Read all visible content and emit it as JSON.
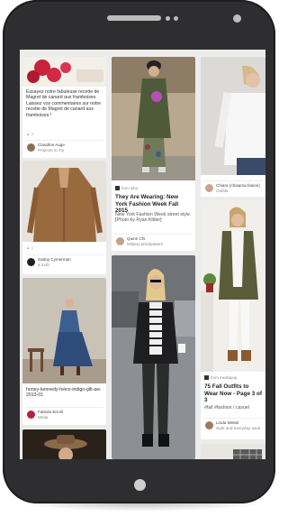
{
  "feed": {
    "col1": {
      "card1": {
        "text": "Essayez notre fabuleuse recette de Magret de canard aux framboises. Laissez vos commentaires sur notre recette de Magret de canard aux framboises !",
        "likes": "▲ 2",
        "user": "Claudine Auge",
        "board": "Projects to Try"
      },
      "card2": {
        "likes": "▲ 1",
        "user": "Sadoy Cymerman",
        "board": "a mob"
      },
      "card3": {
        "text": "honey-kennedy-heinz-indigo-gilt-aw-2013-01",
        "user": "Fabiola Ermili",
        "board": "Moda"
      }
    },
    "col2": {
      "card1": {
        "source": "from who",
        "title": "They Are Wearing: New York Fashion Week Fall 2015",
        "desc": "New York Fashion Week street style. [Photo by Ryan Kibler]",
        "user": "Quinn Chi",
        "board": "Military print/pattern"
      }
    },
    "col3": {
      "card1": {
        "user": "Chiara (chiaama.fasion)",
        "board": "Outfits"
      },
      "card2": {
        "source": "from mediapop",
        "title": "75 Fall Outfits to Wear Now - Page 3 of 3",
        "tags": "#fall #fashion / casuel",
        "user": "Linda Weitel",
        "board": "style and everyday wear"
      }
    }
  },
  "colors": {
    "phone_body": "#2e2e30",
    "screen_bg": "#ececec",
    "card_bg": "#ffffff"
  }
}
